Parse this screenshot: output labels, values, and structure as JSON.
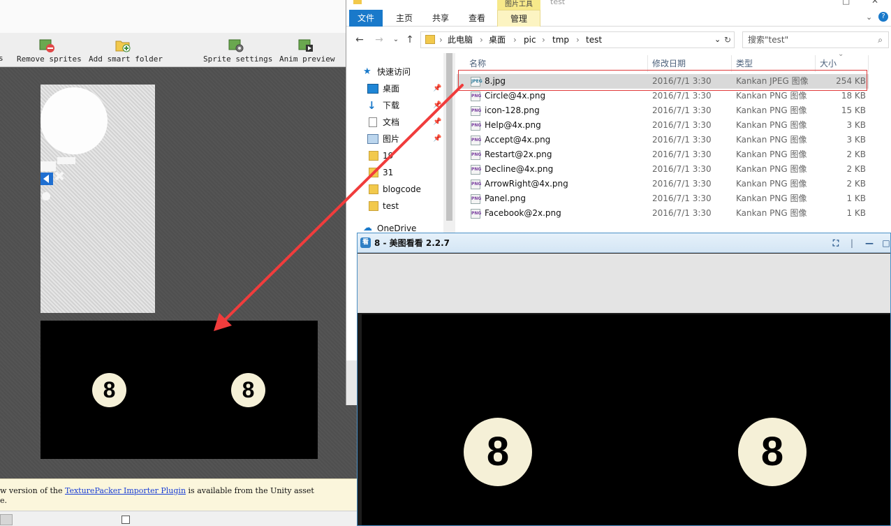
{
  "texturepacker": {
    "toolbar": {
      "partial_left": "s",
      "remove_sprites": "Remove sprites",
      "add_smart_folder": "Add smart folder",
      "sprite_settings": "Sprite settings",
      "anim_preview": "Anim preview"
    },
    "notice": {
      "line1_prefix": "w version of the ",
      "link": "TexturePacker Importer Plugin",
      "line1_suffix": " is available from the Unity asset",
      "line2": "e."
    },
    "preview": {
      "ball_left": "8",
      "ball_right": "8"
    }
  },
  "explorer": {
    "title": "test",
    "ribbon": {
      "file": "文件",
      "home": "主页",
      "share": "共享",
      "view": "查看",
      "picture_tools": "图片工具",
      "manage": "管理"
    },
    "address": {
      "root": "此电脑",
      "seg1": "桌面",
      "seg2": "pic",
      "seg3": "tmp",
      "seg4": "test"
    },
    "search_placeholder": "搜索\"test\"",
    "nav": {
      "quick_access": "快速访问",
      "desktop": "桌面",
      "downloads": "下载",
      "documents": "文档",
      "pictures": "图片",
      "f19": "19",
      "f31": "31",
      "blogcode": "blogcode",
      "test": "test",
      "onedrive": "OneDrive"
    },
    "columns": {
      "name": "名称",
      "date": "修改日期",
      "type": "类型",
      "size": "大小"
    },
    "files": [
      {
        "name": "8.jpg",
        "date": "2016/7/1 3:30",
        "type": "Kankan JPEG 图像",
        "size": "254 KB",
        "icon": "JPEG"
      },
      {
        "name": "Circle@4x.png",
        "date": "2016/7/1 3:30",
        "type": "Kankan PNG 图像",
        "size": "18 KB",
        "icon": "PNG"
      },
      {
        "name": "icon-128.png",
        "date": "2016/7/1 3:30",
        "type": "Kankan PNG 图像",
        "size": "15 KB",
        "icon": "PNG"
      },
      {
        "name": "Help@4x.png",
        "date": "2016/7/1 3:30",
        "type": "Kankan PNG 图像",
        "size": "3 KB",
        "icon": "PNG"
      },
      {
        "name": "Accept@4x.png",
        "date": "2016/7/1 3:30",
        "type": "Kankan PNG 图像",
        "size": "3 KB",
        "icon": "PNG"
      },
      {
        "name": "Restart@2x.png",
        "date": "2016/7/1 3:30",
        "type": "Kankan PNG 图像",
        "size": "2 KB",
        "icon": "PNG"
      },
      {
        "name": "Decline@4x.png",
        "date": "2016/7/1 3:30",
        "type": "Kankan PNG 图像",
        "size": "2 KB",
        "icon": "PNG"
      },
      {
        "name": "ArrowRight@4x.png",
        "date": "2016/7/1 3:30",
        "type": "Kankan PNG 图像",
        "size": "2 KB",
        "icon": "PNG"
      },
      {
        "name": "Panel.png",
        "date": "2016/7/1 3:30",
        "type": "Kankan PNG 图像",
        "size": "1 KB",
        "icon": "PNG"
      },
      {
        "name": "Facebook@2x.png",
        "date": "2016/7/1 3:30",
        "type": "Kankan PNG 图像",
        "size": "1 KB",
        "icon": "PNG"
      }
    ]
  },
  "viewer": {
    "title": "8 - 美图看看 2.2.7",
    "ball_left": "8",
    "ball_right": "8"
  },
  "colors": {
    "accent_blue": "#1979ca",
    "highlight_red": "#e03a3a",
    "ball_cream": "#f5f0d7"
  }
}
